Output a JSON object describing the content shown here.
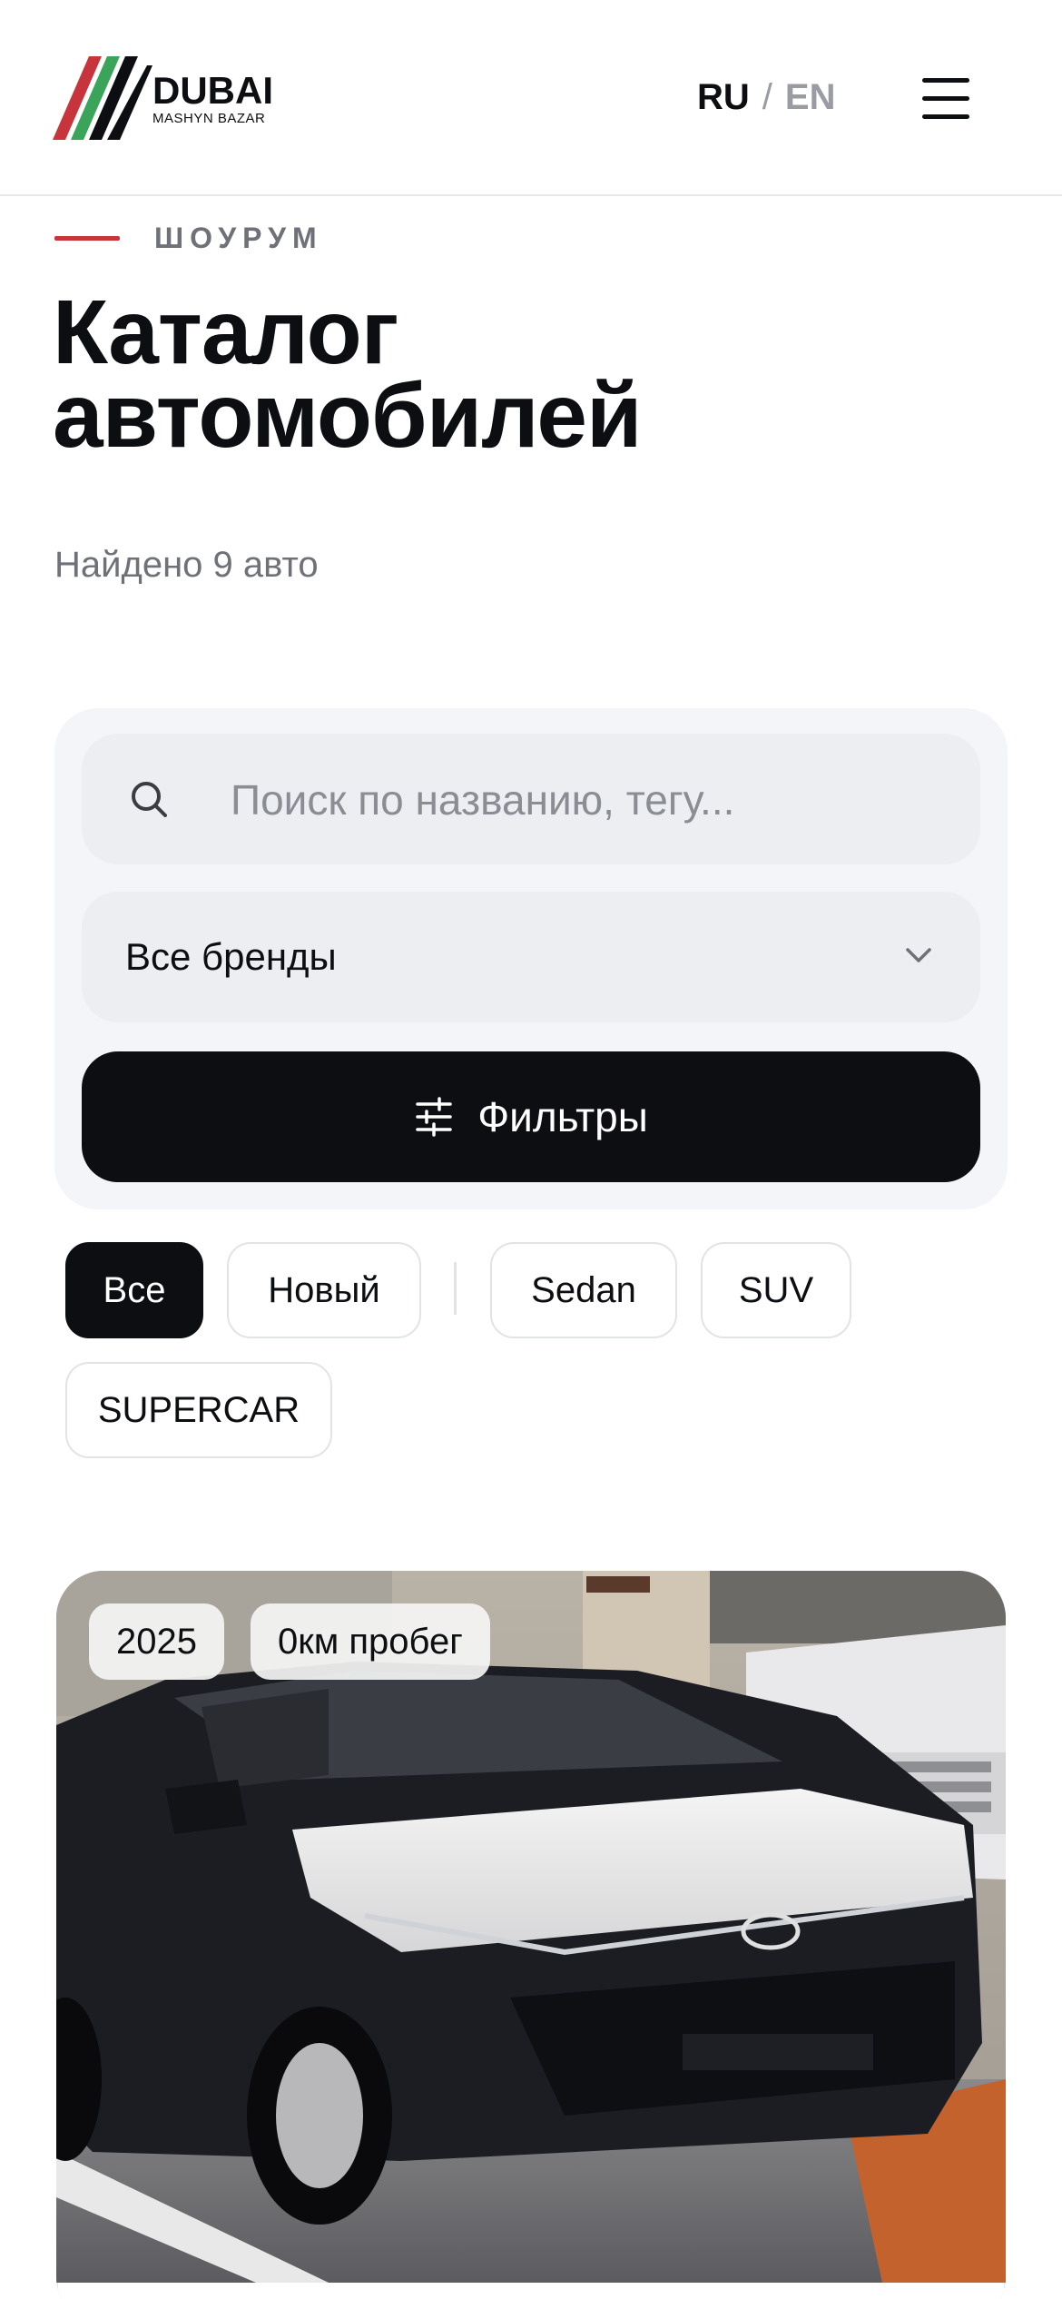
{
  "header": {
    "logo_title": "DUBAI",
    "logo_subtitle": "MASHYN BAZAR",
    "lang_ru": "RU",
    "lang_sep": "/",
    "lang_en": "EN",
    "menu_icon": "hamburger-menu-icon"
  },
  "hero": {
    "eyebrow": "ШОУРУМ",
    "title_line1": "Каталог",
    "title_line2": "автомобилей",
    "found": "Найдено 9 авто"
  },
  "filters": {
    "search_placeholder": "Поиск по названию, тегу...",
    "brand_select": "Все бренды",
    "filters_button": "Фильтры"
  },
  "chips": [
    {
      "label": "Все",
      "active": true
    },
    {
      "label": "Новый",
      "active": false
    },
    {
      "label": "Sedan",
      "active": false
    },
    {
      "label": "SUV",
      "active": false
    },
    {
      "label": "SUPERCAR",
      "active": false
    }
  ],
  "cards": [
    {
      "year": "2025",
      "mileage": "0км пробег"
    }
  ],
  "colors": {
    "accent_red": "#c8343c",
    "logo_green": "#3aa45b",
    "dark": "#0d0e12",
    "muted": "#6f7178"
  }
}
